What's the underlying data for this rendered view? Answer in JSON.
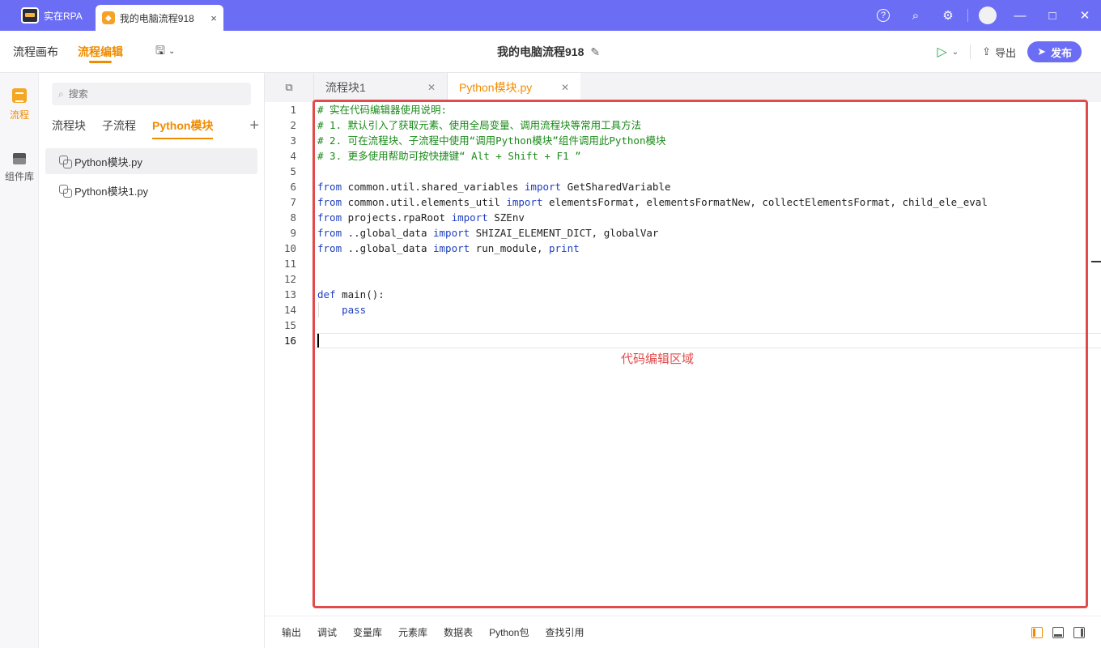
{
  "app": {
    "name": "实在RPA"
  },
  "window_tab": {
    "label": "我的电脑流程918",
    "close": "×"
  },
  "title_controls": {
    "help": "?",
    "search": "⌕",
    "settings": "⚙",
    "minimize": "—",
    "maximize": "□",
    "close": "✕"
  },
  "toolbar": {
    "canvas_label": "流程画布",
    "edit_label": "流程编辑",
    "save_icon": "💾",
    "flow_title": "我的电脑流程918",
    "export_label": "导出",
    "publish_label": "发布"
  },
  "rail": {
    "items": [
      {
        "label": "流程",
        "icon": "list-icon"
      },
      {
        "label": "组件库",
        "icon": "layers-icon"
      }
    ]
  },
  "sidebar": {
    "search_placeholder": "搜索",
    "tabs": [
      {
        "label": "流程块"
      },
      {
        "label": "子流程"
      },
      {
        "label": "Python模块"
      }
    ],
    "add": "+",
    "files": [
      {
        "label": "Python模块.py"
      },
      {
        "label": "Python模块1.py"
      }
    ]
  },
  "editor": {
    "tabs": [
      {
        "label": "流程块1",
        "close": "✕"
      },
      {
        "label": "Python模块.py",
        "close": "✕"
      }
    ],
    "line_numbers": [
      "1",
      "2",
      "3",
      "4",
      "5",
      "6",
      "7",
      "8",
      "9",
      "10",
      "11",
      "12",
      "13",
      "14",
      "15",
      "16"
    ],
    "code": {
      "l1": "# 实在代码编辑器使用说明:",
      "l2": "# 1. 默认引入了获取元素、使用全局变量、调用流程块等常用工具方法",
      "l3": "# 2. 可在流程块、子流程中使用“调用Python模块”组件调用此Python模块",
      "l4": "# 3. 更多使用帮助可按快捷键“ Alt + Shift + F1 ”",
      "kw_from": "from",
      "kw_import": "import",
      "kw_def": "def",
      "l6a": " common.util.shared_variables ",
      "l6b": " GetSharedVariable",
      "l7a": " common.util.elements_util ",
      "l7b": " elementsFormat, elementsFormatNew, collectElementsFormat, child_ele_eval",
      "l8a": " projects.rpaRoot ",
      "l8b": " SZEnv",
      "l9a": " ..global_data ",
      "l9b": " SHIZAI_ELEMENT_DICT, globalVar",
      "l10a": " ..global_data ",
      "l10b": " run_module, ",
      "l10c": "print",
      "l13": " main():",
      "l14": "    pass"
    },
    "annotation": "代码编辑区域"
  },
  "bottom": {
    "items": [
      "输出",
      "调试",
      "变量库",
      "元素库",
      "数据表",
      "Python包",
      "查找引用"
    ]
  }
}
